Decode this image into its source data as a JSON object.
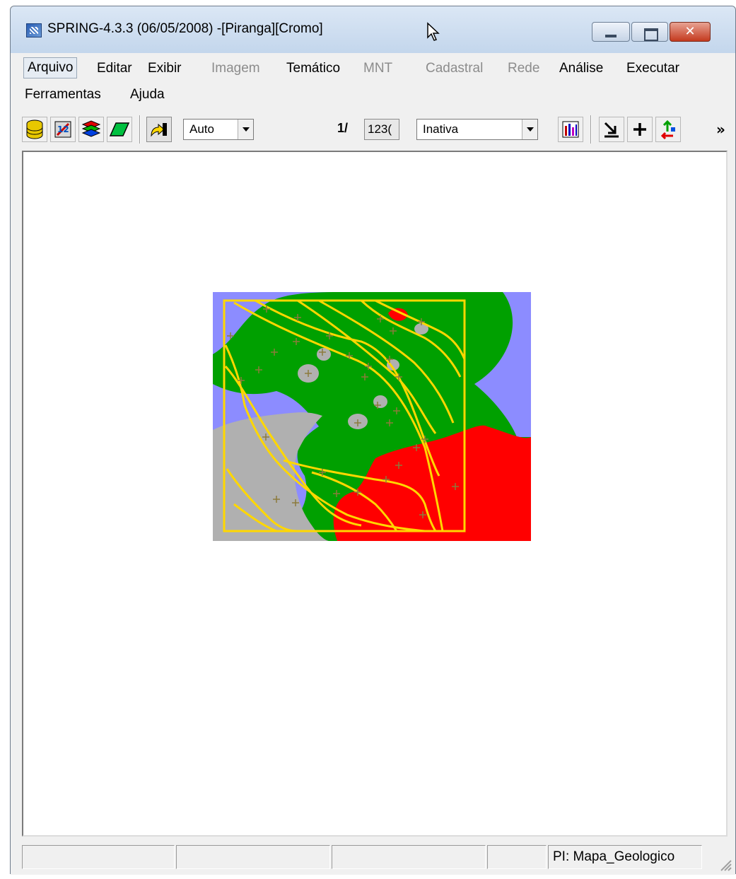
{
  "window": {
    "title": "SPRING-4.3.3 (06/05/2008) -[Piranga][Cromo]",
    "close_glyph": "✕"
  },
  "menubar": {
    "items": [
      {
        "label": "Arquivo",
        "enabled": true
      },
      {
        "label": "Editar",
        "enabled": true
      },
      {
        "label": "Exibir",
        "enabled": true
      },
      {
        "label": "Imagem",
        "enabled": false
      },
      {
        "label": "Temático",
        "enabled": true
      },
      {
        "label": "MNT",
        "enabled": false
      },
      {
        "label": "Cadastral",
        "enabled": false
      },
      {
        "label": "Rede",
        "enabled": false
      },
      {
        "label": "Análise",
        "enabled": true
      },
      {
        "label": "Executar",
        "enabled": true
      },
      {
        "label": "Ferramentas",
        "enabled": true
      },
      {
        "label": "Ajuda",
        "enabled": true
      }
    ]
  },
  "toolbar": {
    "zoom_mode": "Auto",
    "scale_prefix": "1/",
    "scale_value": "123(",
    "cursor_mode": "Inativa",
    "overflow_glyph": "»",
    "icons": [
      "database-icon",
      "tool-icon",
      "layers-icon",
      "plane-icon",
      "pointer-icon",
      "chart-icon",
      "arrow-down-right-icon",
      "plus-icon",
      "swap-icon"
    ]
  },
  "map": {
    "colors": {
      "background": "#8c8cff",
      "green": "#00a000",
      "red": "#ff0000",
      "gray": "#b0b0b0",
      "lines": "#ffd700",
      "points": "#8c7a3c"
    }
  },
  "statusbar": {
    "panels": [
      "",
      "",
      "",
      "",
      "PI: Mapa_Geologico"
    ]
  }
}
